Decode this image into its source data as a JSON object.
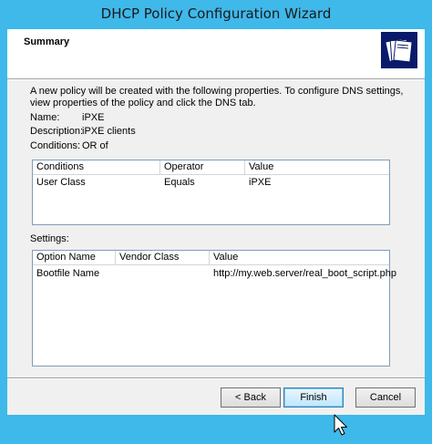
{
  "window": {
    "title": "DHCP Policy Configuration Wizard"
  },
  "header": {
    "title": "Summary",
    "icon": "folders-icon"
  },
  "intro": {
    "line1": "A new policy will be created with the following properties. To configure DNS settings,",
    "line2": "view properties of the policy and click the DNS tab."
  },
  "properties": {
    "name_label": "Name:",
    "name_value": "iPXE",
    "description_label": "Description:",
    "description_value": "iPXE clients",
    "conditions_label": "Conditions:",
    "conditions_value": "OR of"
  },
  "conditions_table": {
    "columns": [
      "Conditions",
      "Operator",
      "Value"
    ],
    "rows": [
      [
        "User Class",
        "Equals",
        "iPXE"
      ]
    ]
  },
  "settings": {
    "label": "Settings:",
    "columns": [
      "Option Name",
      "Vendor Class",
      "Value"
    ],
    "rows": [
      [
        "Bootfile Name",
        "",
        "http://my.web.server/real_boot_script.php"
      ]
    ]
  },
  "buttons": {
    "back": "< Back",
    "finish": "Finish",
    "cancel": "Cancel"
  }
}
